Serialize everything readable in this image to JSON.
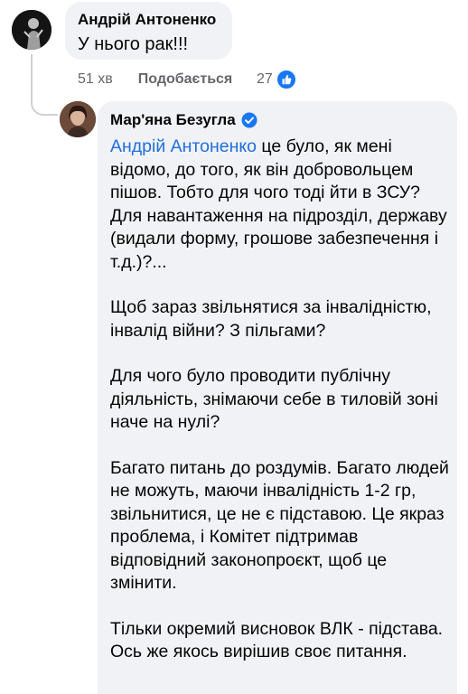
{
  "first_comment": {
    "author": "Андрій Антоненко",
    "text": "У нього рак!!!",
    "time": "51 хв",
    "like_label": "Подобається",
    "reaction_count": "27",
    "reaction_icon": "thumbs-up-icon"
  },
  "reply": {
    "author": "Мар'яна Безугла",
    "verified_icon": "verified-badge-icon",
    "mention": "Андрій Антоненко",
    "paragraph1_rest": " це було, як мені відомо, до того, як він добровольцем пішов. Тобто для чого тоді йти в ЗСУ? Для навантаження на підрозділ, державу (видали форму, грошове забезпечення і т.д.)?...",
    "paragraph2": "Щоб зараз звільнятися за інвалідністю, інвалід війни? З пільгами?",
    "paragraph3": "Для чого було проводити публічну діяльність, знімаючи себе в тиловій зоні наче на нулі?",
    "paragraph4": "Багато питань до роздумів. Багато людей не можуть, маючи інвалідність 1-2 гр, звільнитися, це не є підставою. Це якраз проблема, і Комітет підтримав відповідний законопроєкт, щоб це змінити.",
    "paragraph5": "Тільки окремий висновок ВЛК - підстава. Ось же якось вирішив своє питання."
  },
  "colors": {
    "bubble_bg": "#f0f2f5",
    "link": "#216fdb",
    "meta_text": "#65676b",
    "like_blue": "#1877f2"
  }
}
